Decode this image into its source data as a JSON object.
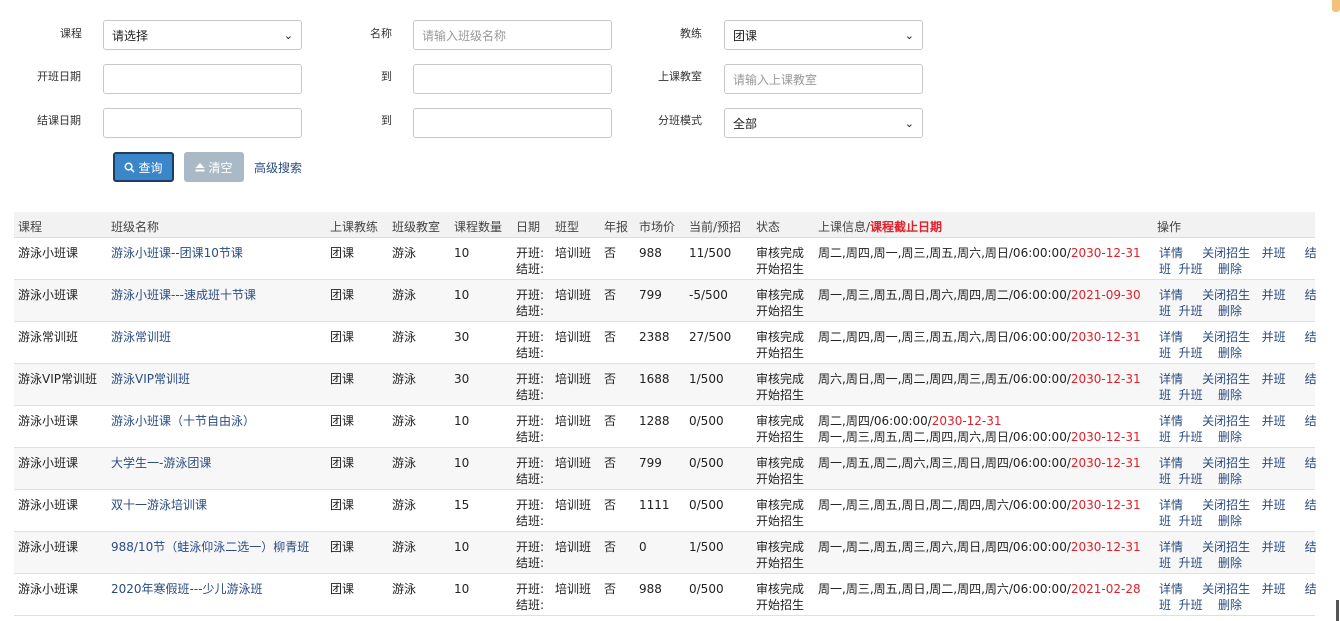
{
  "filters": {
    "course_label": "课程",
    "course_value": "请选择",
    "name_label": "名称",
    "name_placeholder": "请输入班级名称",
    "coach_label": "教练",
    "coach_value": "团课",
    "start_date_label": "开班日期",
    "to_label_1": "到",
    "classroom_label": "上课教室",
    "classroom_placeholder": "请输入上课教室",
    "end_date_label": "结课日期",
    "to_label_2": "到",
    "mode_label": "分班模式",
    "mode_value": "全部"
  },
  "actions": {
    "query_label": "查询",
    "clear_label": "清空",
    "advanced_label": "高级搜索"
  },
  "table": {
    "headers": {
      "course": "课程",
      "class_name": "班级名称",
      "coach": "上课教练",
      "classroom": "班级教室",
      "count": "课程数量",
      "date": "日期",
      "type": "班型",
      "annual": "年报",
      "price": "市场价",
      "enroll": "当前/预招",
      "status": "状态",
      "info_prefix": "上课信息/",
      "info_deadline": "课程截止日期",
      "ops": "操作"
    },
    "date_start_label": "开班:",
    "date_end_label": "结班:",
    "status_line1": "审核完成",
    "status_line2": "开始招生",
    "op_detail": "详情",
    "op_close": "关闭招生",
    "op_merge": "并班",
    "op_finish_a": "结",
    "op_finish_b": "班",
    "op_upgrade": "升班",
    "op_delete": "删除",
    "rows": [
      {
        "course": "游泳小班课",
        "class_name": "游泳小班课--团课10节课",
        "coach": "团课",
        "classroom": "游泳",
        "count": "10",
        "type": "培训班",
        "annual": "否",
        "price": "988",
        "enroll": "11/500",
        "info": "周二,周四,周一,周三,周五,周六,周日/06:00:00/",
        "info2": "",
        "deadline": "2030-12-31"
      },
      {
        "course": "游泳小班课",
        "class_name": "游泳小班课---速成班十节课",
        "coach": "团课",
        "classroom": "游泳",
        "count": "10",
        "type": "培训班",
        "annual": "否",
        "price": "799",
        "enroll": "-5/500",
        "info": "周一,周三,周五,周日,周六,周四,周二/06:00:00/",
        "info2": "",
        "deadline": "2021-09-30"
      },
      {
        "course": "游泳常训班",
        "class_name": "游泳常训班",
        "coach": "团课",
        "classroom": "游泳",
        "count": "30",
        "type": "培训班",
        "annual": "否",
        "price": "2388",
        "enroll": "27/500",
        "info": "周二,周四,周一,周三,周五,周六,周日/06:00:00/",
        "info2": "",
        "deadline": "2030-12-31"
      },
      {
        "course": "游泳VIP常训班",
        "class_name": "游泳VIP常训班",
        "coach": "团课",
        "classroom": "游泳",
        "count": "30",
        "type": "培训班",
        "annual": "否",
        "price": "1688",
        "enroll": "1/500",
        "info": "周六,周日,周一,周二,周四,周三,周五/06:00:00/",
        "info2": "",
        "deadline": "2030-12-31"
      },
      {
        "course": "游泳小班课",
        "class_name": "游泳小班课（十节自由泳）",
        "coach": "团课",
        "classroom": "游泳",
        "count": "10",
        "type": "培训班",
        "annual": "否",
        "price": "1288",
        "enroll": "0/500",
        "info": "周二,周四/06:00:00/",
        "info2": "周一,周三,周五,周二,周四,周六,周日/06:00:00/",
        "deadline": "2030-12-31",
        "deadline2": "2030-12-31"
      },
      {
        "course": "游泳小班课",
        "class_name": "大学生一-游泳团课",
        "coach": "团课",
        "classroom": "游泳",
        "count": "10",
        "type": "培训班",
        "annual": "否",
        "price": "799",
        "enroll": "0/500",
        "info": "周一,周五,周二,周六,周三,周日,周四/06:00:00/",
        "info2": "",
        "deadline": "2030-12-31"
      },
      {
        "course": "游泳小班课",
        "class_name": "双十一游泳培训课",
        "coach": "团课",
        "classroom": "游泳",
        "count": "15",
        "type": "培训班",
        "annual": "否",
        "price": "1111",
        "enroll": "0/500",
        "info": "周一,周三,周五,周日,周二,周四,周六/06:00:00/",
        "info2": "",
        "deadline": "2030-12-31"
      },
      {
        "course": "游泳小班课",
        "class_name": "988/10节（蛙泳仰泳二选一）柳青班",
        "coach": "团课",
        "classroom": "游泳",
        "count": "10",
        "type": "培训班",
        "annual": "否",
        "price": "0",
        "enroll": "1/500",
        "info": "周一,周二,周五,周三,周六,周日,周四/06:00:00/",
        "info2": "",
        "deadline": "2030-12-31"
      },
      {
        "course": "游泳小班课",
        "class_name": "2020年寒假班---少儿游泳班",
        "coach": "团课",
        "classroom": "游泳",
        "count": "10",
        "type": "培训班",
        "annual": "否",
        "price": "988",
        "enroll": "0/500",
        "info": "周一,周三,周五,周日,周二,周四,周六/06:00:00/",
        "info2": "",
        "deadline": "2021-02-28"
      }
    ]
  }
}
